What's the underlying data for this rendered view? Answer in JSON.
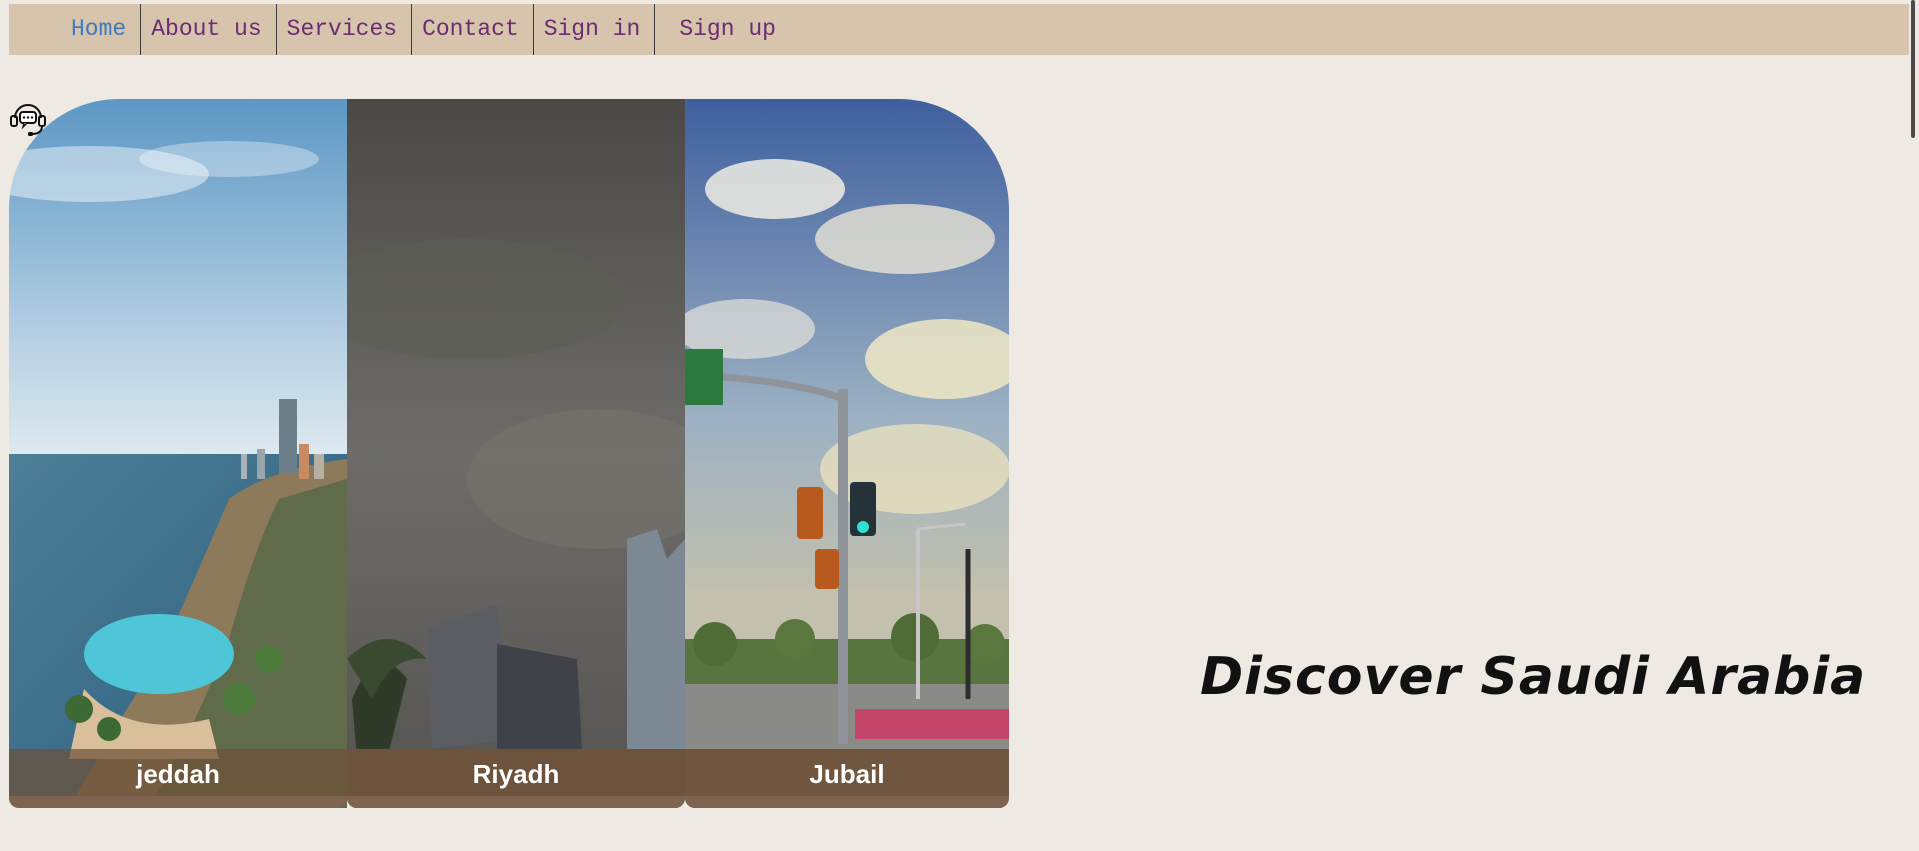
{
  "nav": {
    "items": [
      {
        "label": "Home",
        "active": true
      },
      {
        "label": "About us",
        "active": false
      },
      {
        "label": "Services",
        "active": false
      },
      {
        "label": "Contact",
        "active": false
      },
      {
        "label": "Sign in",
        "active": false
      },
      {
        "label": "Sign up",
        "active": false
      }
    ]
  },
  "support_icon": "headset-chat-icon",
  "gallery": {
    "panels": [
      {
        "caption": "jeddah"
      },
      {
        "caption": "Riyadh"
      },
      {
        "caption": "Jubail"
      }
    ]
  },
  "headline": "Discover Saudi Arabia",
  "colors": {
    "background": "#eee9e3",
    "nav_background": "#d6c4ac",
    "nav_link": "#6b2c72",
    "nav_active": "#3f79c0"
  }
}
